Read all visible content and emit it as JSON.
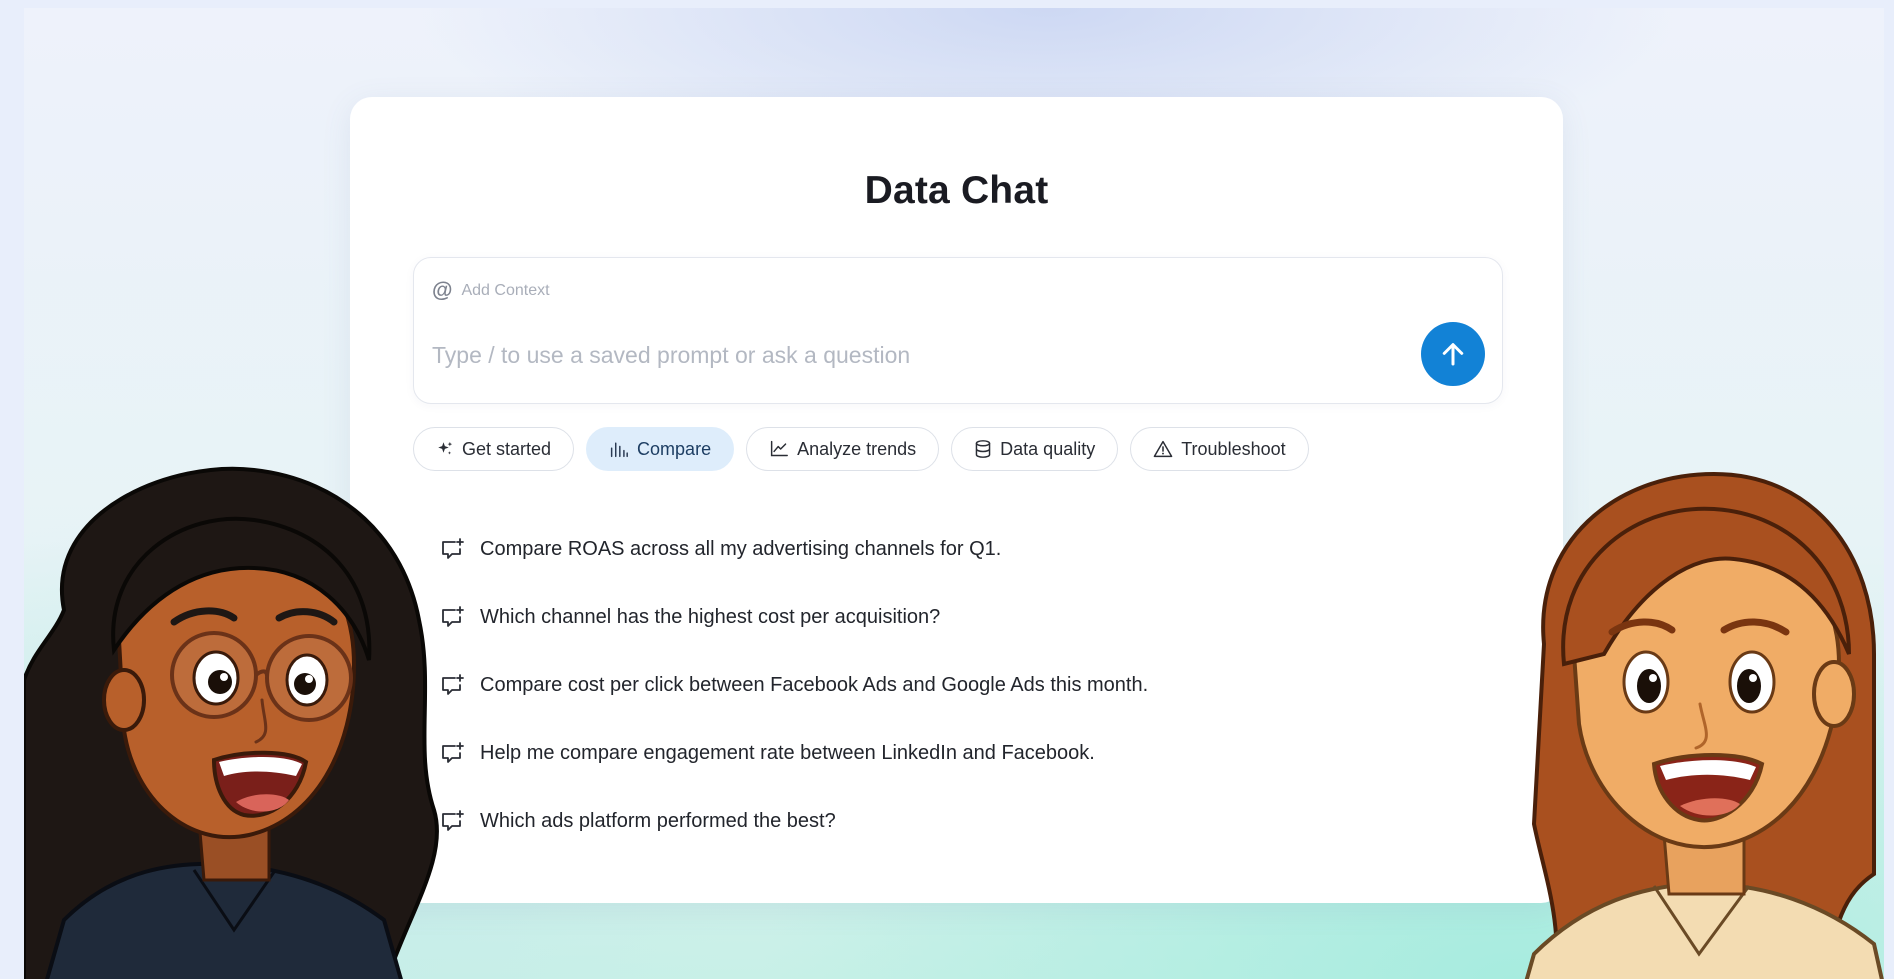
{
  "app": {
    "title": "Data Chat"
  },
  "composer": {
    "context_label": "Add Context",
    "placeholder": "Type / to use a saved prompt or ask a question",
    "at_symbol": "@",
    "send_icon": "arrow-up-icon",
    "accent_color": "#1282d6"
  },
  "chips": [
    {
      "label": "Get started",
      "icon": "sparkle-icon",
      "active": false
    },
    {
      "label": "Compare",
      "icon": "bar-chart-icon",
      "active": true
    },
    {
      "label": "Analyze trends",
      "icon": "line-chart-icon",
      "active": false
    },
    {
      "label": "Data quality",
      "icon": "database-icon",
      "active": false
    },
    {
      "label": "Troubleshoot",
      "icon": "warning-icon",
      "active": false
    }
  ],
  "suggestions": [
    {
      "text": "Compare ROAS across all my advertising channels for Q1."
    },
    {
      "text": "Which channel has the highest cost per acquisition?"
    },
    {
      "text": "Compare cost per click between Facebook Ads and Google Ads this month."
    },
    {
      "text": "Help me compare engagement rate between LinkedIn and Facebook."
    },
    {
      "text": "Which ads platform performed the best?"
    }
  ]
}
